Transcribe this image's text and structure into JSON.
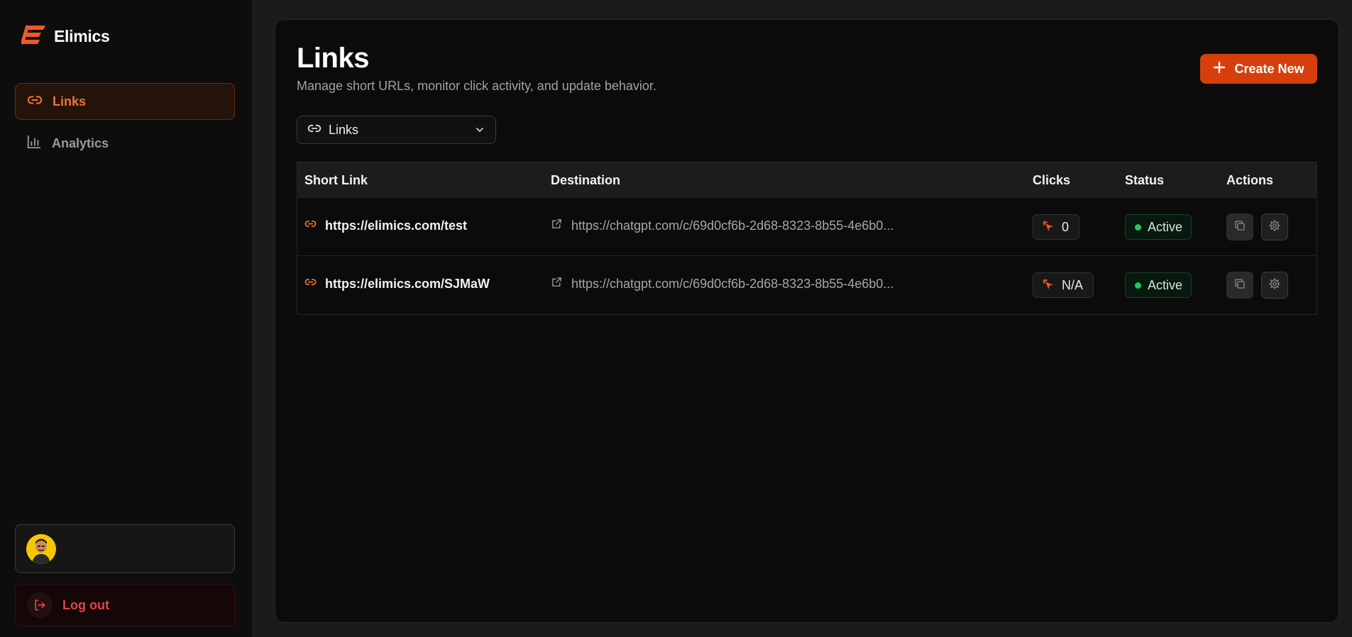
{
  "app": {
    "brand_name": "Elimics"
  },
  "sidebar": {
    "items": [
      {
        "label": "Links",
        "icon": "link-icon",
        "active": true
      },
      {
        "label": "Analytics",
        "icon": "bar-chart-icon",
        "active": false
      }
    ],
    "logout_label": "Log out"
  },
  "header": {
    "title": "Links",
    "subtitle": "Manage short URLs, monitor click activity, and update behavior.",
    "create_label": "Create New"
  },
  "view_select": {
    "value": "Links"
  },
  "table": {
    "columns": [
      "Short Link",
      "Destination",
      "Clicks",
      "Status",
      "Actions"
    ],
    "rows": [
      {
        "short_link": "https://elimics.com/test",
        "destination": "https://chatgpt.com/c/69d0cf6b-2d68-8323-8b55-4e6b0...",
        "clicks": "0",
        "status": "Active"
      },
      {
        "short_link": "https://elimics.com/SJMaW",
        "destination": "https://chatgpt.com/c/69d0cf6b-2d68-8323-8b55-4e6b0...",
        "clicks": "N/A",
        "status": "Active"
      }
    ]
  },
  "colors": {
    "accent": "#f47234",
    "button": "#d63f0c",
    "status_active": "#22c55e",
    "logout": "#e04545"
  }
}
